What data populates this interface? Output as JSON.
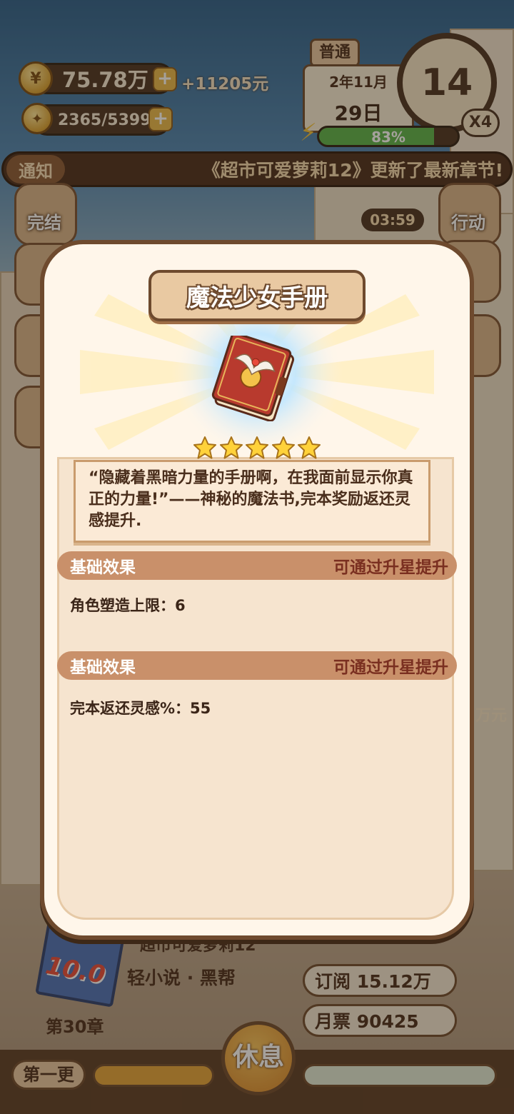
{
  "hud": {
    "money": "75.78万",
    "money_gain": "+11205元",
    "inspiration": "2365/5399",
    "difficulty": "普通",
    "date_month": "2年11月",
    "date_day": "29日",
    "clock_value": "14",
    "speed": "X4",
    "energy_percent_label": "83%",
    "energy_fraction": 0.83
  },
  "notice": {
    "tag": "通知",
    "text": "《超市可爱萝莉12》更新了最新章节!"
  },
  "side_buttons": {
    "finish": "完结",
    "action": "行动",
    "timer": "03:59"
  },
  "modal": {
    "title": "魔法少女手册",
    "stars": 5,
    "description": "“隐藏着黑暗力量的手册啊，在我面前显示你真正的力量!”——神秘的魔法书,完本奖励返还灵感提升.",
    "sections": [
      {
        "header": "基础效果",
        "hint": "可通过升星提升",
        "effect": "角色塑造上限：6"
      },
      {
        "header": "基础效果",
        "hint": "可通过升星提升",
        "effect": "完本返还灵感%：55"
      }
    ]
  },
  "bottom": {
    "book_title": "超市可爱萝莉12",
    "genre": "轻小说 · 黑帮",
    "score": "10.0",
    "chapter": "第30章",
    "subscribe": "订阅 15.12万",
    "monthly_ticket": "月票 90425",
    "update_button": "第一更",
    "rest_button": "休息",
    "side_money_suffix": "万元"
  },
  "colors": {
    "accent_brown": "#6e4a2e",
    "section_header": "#c9906a",
    "hint_red": "#7a2f20",
    "star_gold": "#ffd23a"
  }
}
